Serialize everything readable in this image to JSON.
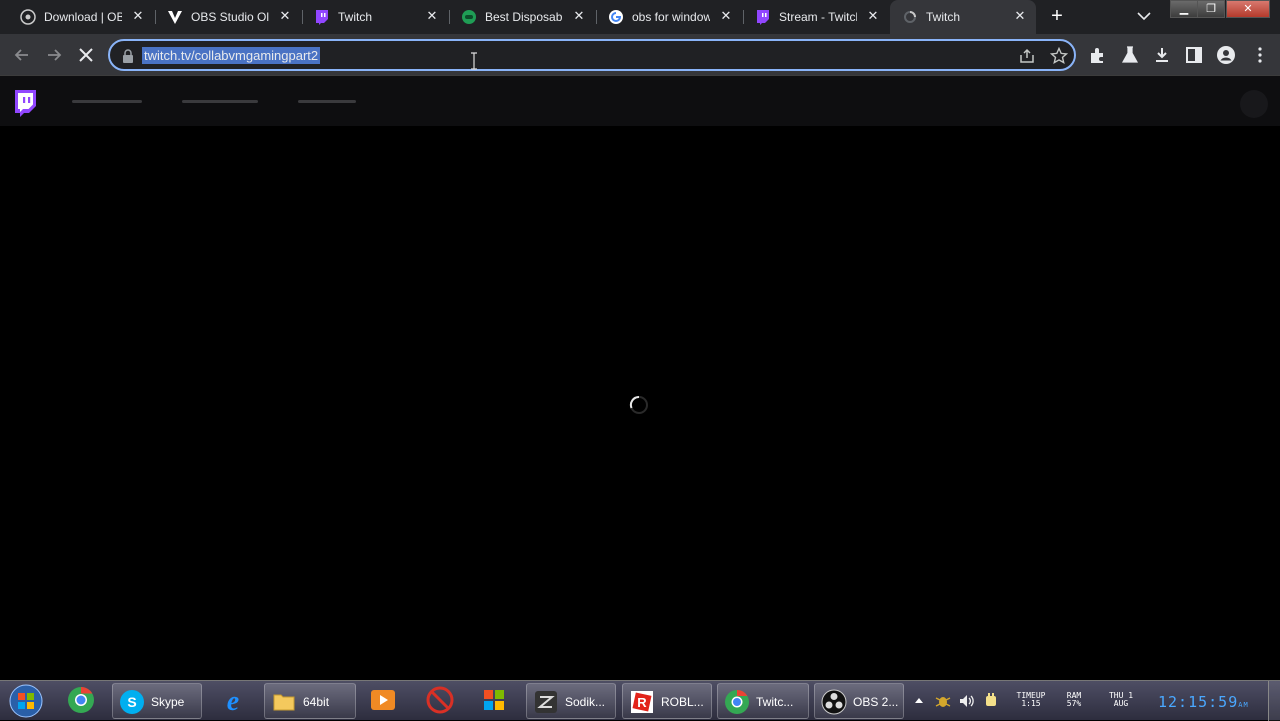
{
  "browser": {
    "tabs": [
      {
        "title": "Download | OBS",
        "icon": "obs-icon"
      },
      {
        "title": "OBS Studio Old",
        "icon": "v-icon"
      },
      {
        "title": "Twitch",
        "icon": "twitch-icon"
      },
      {
        "title": "Best Disposable",
        "icon": "green-circle-icon"
      },
      {
        "title": "obs for windows",
        "icon": "google-icon"
      },
      {
        "title": "Stream - Twitch",
        "icon": "twitch-icon"
      },
      {
        "title": "Twitch",
        "icon": "loading-icon",
        "active": true
      }
    ],
    "new_tab_label": "+",
    "address": {
      "url": "twitch.tv/collabvmgamingpart2"
    },
    "colors": {
      "accent": "#8ab4f8",
      "twitch_purple": "#9146ff",
      "selection": "#4a73c4"
    }
  },
  "page": {
    "state": "loading"
  },
  "taskbar": {
    "buttons": [
      {
        "label": "Skype",
        "icon": "skype-icon"
      },
      {
        "label": "64bit",
        "icon": "folder-icon"
      },
      {
        "label": "Sodik...",
        "icon": "sodik-icon"
      },
      {
        "label": "ROBL...",
        "icon": "roblox-icon"
      },
      {
        "label": "Twitc...",
        "icon": "chrome-icon"
      },
      {
        "label": "OBS 2...",
        "icon": "obs-icon"
      }
    ],
    "gadgets": {
      "timeup_label": "TIMEUP",
      "timeup_value": "1:15",
      "ram_label": "RAM",
      "ram_value": "57%",
      "date_line1": "THU 1",
      "date_line2": "AUG"
    },
    "clock": {
      "time": "12:15:59",
      "ampm": "AM"
    }
  }
}
